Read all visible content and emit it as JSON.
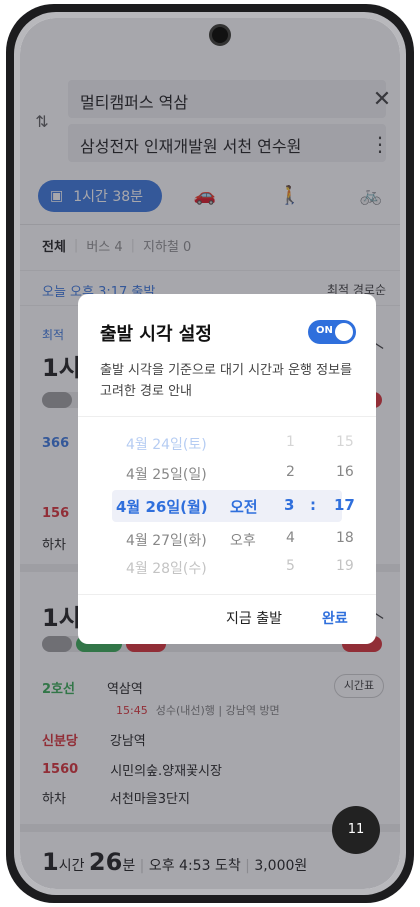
{
  "route": {
    "origin": "멀티캠퍼스 역삼",
    "destination": "삼성전자 인재개발원 서천 연수원"
  },
  "modes": {
    "active_label": "1시간 38분",
    "icons": [
      "bus-icon",
      "car-icon",
      "walk-icon",
      "bike-icon"
    ]
  },
  "filters": {
    "all": "전체",
    "bus": "버스 4",
    "subway": "지하철 0"
  },
  "timebar": {
    "departure": "오늘 오후 3:17 출발",
    "sort": "최적 경로순"
  },
  "card1": {
    "badge": "최적",
    "duration": "1시간",
    "lines": [
      "366",
      "156",
      "하차"
    ]
  },
  "card2": {
    "duration": "1시간",
    "line1_tag": "2호선",
    "line1_station": "역삼역",
    "line1_detail_time": "15:45",
    "line1_detail": "성수(내선)행 | 강남역 방면",
    "schedule_button": "시간표",
    "line2_tag": "신분당",
    "line2_station": "강남역",
    "line3_tag": "1560",
    "line3_station": "시민의숲.양재꽃시장",
    "line4_tag": "하차",
    "line4_station": "서천마을3단지"
  },
  "card3": {
    "duration_num": "1",
    "duration_unit": "시간",
    "duration_min": "26",
    "duration_min_unit": "분",
    "arrival": "오후 4:53 도착",
    "fare": "3,000원"
  },
  "fab": {
    "label": "11"
  },
  "dialog": {
    "title": "출발 시각 설정",
    "toggle_label": "ON",
    "description": "출발 시각을 기준으로 대기 시간과 운행 정보를 고려한 경로 안내",
    "picker": {
      "rows": [
        {
          "date": "4월 24일(토)",
          "ampm": "",
          "hour": "1",
          "minute": "15"
        },
        {
          "date": "4월 25일(일)",
          "ampm": "",
          "hour": "2",
          "minute": "16"
        },
        {
          "date": "4월 26일(월)",
          "ampm": "오전",
          "hour": "3",
          "minute": "17"
        },
        {
          "date": "4월 27일(화)",
          "ampm": "오후",
          "hour": "4",
          "minute": "18"
        },
        {
          "date": "4월 28일(수)",
          "ampm": "",
          "hour": "5",
          "minute": "19"
        }
      ],
      "colon": ":"
    },
    "btn_now": "지금 출발",
    "btn_done": "완료"
  }
}
